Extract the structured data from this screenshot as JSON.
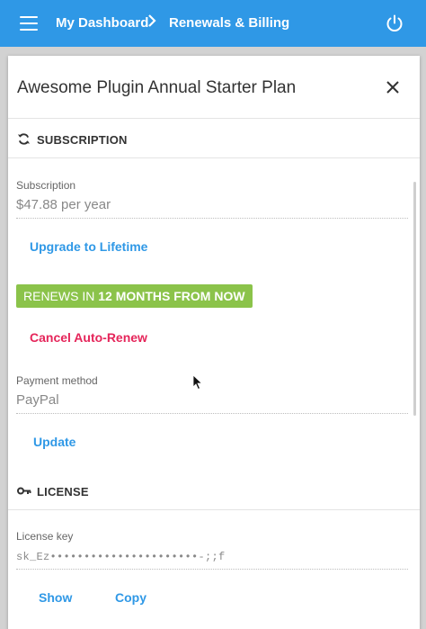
{
  "topbar": {
    "breadcrumb_1": "My Dashboard",
    "breadcrumb_2": "Renewals & Billing",
    "menu_icon": "hamburger-menu-icon",
    "power_icon": "power-icon",
    "chevron_icon": "chevron-right-icon"
  },
  "card": {
    "title": "Awesome Plugin Annual Starter Plan",
    "close_icon": "close-icon"
  },
  "subscription_section": {
    "heading": "SUBSCRIPTION",
    "icon": "refresh-icon",
    "subscription_label": "Subscription",
    "subscription_value": "$47.88 per year",
    "upgrade_label": "Upgrade to Lifetime",
    "renew_badge_prefix": "RENEWS IN",
    "renew_badge_value": "12 MONTHS FROM NOW",
    "cancel_label": "Cancel Auto-Renew",
    "payment_label": "Payment method",
    "payment_value": "PayPal",
    "update_label": "Update"
  },
  "license_section": {
    "heading": "LICENSE",
    "icon": "key-icon",
    "license_label": "License key",
    "license_value": "sk_Ez••••••••••••••••••••••-;;f",
    "show_label": "Show",
    "copy_label": "Copy"
  },
  "colors": {
    "accent": "#2f98e6",
    "success": "#8bc34a",
    "danger": "#e5255a"
  }
}
